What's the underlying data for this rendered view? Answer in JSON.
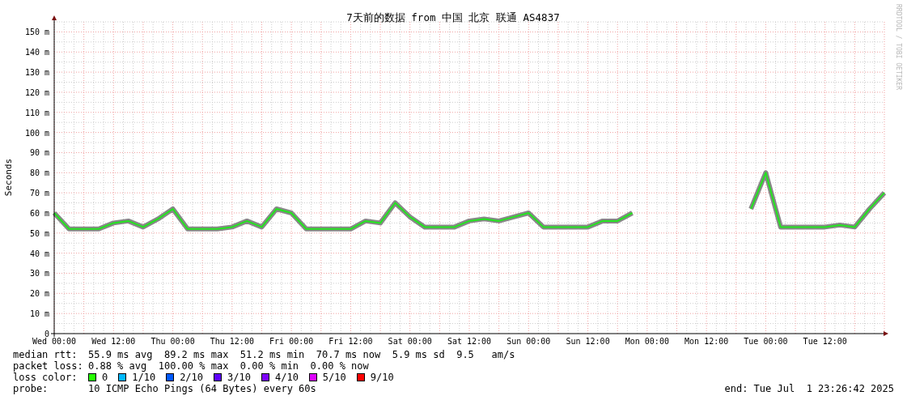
{
  "chart": {
    "chart_data": {
      "type": "line",
      "title": "7天前的数据 from 中国 北京 联通 AS4837",
      "ylabel": "Seconds",
      "categories": [
        "Wed 00:00",
        null,
        null,
        null,
        "Wed 12:00",
        null,
        null,
        null,
        "Thu 00:00",
        null,
        null,
        null,
        "Thu 12:00",
        null,
        null,
        null,
        "Fri 00:00",
        null,
        null,
        null,
        "Fri 12:00",
        null,
        null,
        null,
        "Sat 00:00",
        null,
        null,
        null,
        "Sat 12:00",
        null,
        null,
        null,
        "Sun 00:00",
        null,
        null,
        null,
        "Sun 12:00",
        null,
        null,
        null,
        "Mon 00:00",
        null,
        null,
        null,
        "Mon 12:00",
        null,
        null,
        null,
        "Tue 00:00",
        null,
        null,
        null,
        "Tue 12:00",
        null,
        null,
        null,
        null
      ],
      "series": [
        {
          "color": "#22e41e",
          "values": [
            60,
            52,
            52,
            52,
            55,
            56,
            53,
            57,
            62,
            52,
            52,
            52,
            53,
            56,
            53,
            62,
            60,
            52,
            52,
            52,
            52,
            56,
            55,
            65,
            58,
            53,
            53,
            53,
            56,
            57,
            56,
            58,
            60,
            53,
            53,
            53,
            53,
            56,
            56,
            60,
            null,
            null,
            null,
            null,
            null,
            null,
            null,
            62,
            80,
            53,
            53,
            53,
            53,
            54,
            53,
            62,
            70
          ]
        }
      ],
      "ylim": [
        0,
        155
      ],
      "grid": true,
      "yticks": [
        {
          "value": 0,
          "label": "0"
        },
        {
          "value": 10,
          "label": "10 m"
        },
        {
          "value": 20,
          "label": "20 m"
        },
        {
          "value": 30,
          "label": "30 m"
        },
        {
          "value": 40,
          "label": "40 m"
        },
        {
          "value": 50,
          "label": "50 m"
        },
        {
          "value": 60,
          "label": "60 m"
        },
        {
          "value": 70,
          "label": "70 m"
        },
        {
          "value": 80,
          "label": "80 m"
        },
        {
          "value": 90,
          "label": "90 m"
        },
        {
          "value": 100,
          "label": "100 m"
        },
        {
          "value": 110,
          "label": "110 m"
        },
        {
          "value": 120,
          "label": "120 m"
        },
        {
          "value": 130,
          "label": "130 m"
        },
        {
          "value": 140,
          "label": "140 m"
        },
        {
          "value": 150,
          "label": "150 m"
        }
      ]
    },
    "credit": "RRDTOOL / TOBI OETIKER"
  },
  "stats": [
    {
      "label": "median rtt:",
      "value": "55.9 ms avg  89.2 ms max  51.2 ms min  70.7 ms now  5.9 ms sd  9.5   am/s"
    },
    {
      "label": "packet loss:",
      "value": "0.88 % avg  100.00 % max  0.00 % min  0.00 % now"
    }
  ],
  "loss_colors": {
    "label": "loss color:",
    "items": [
      {
        "label": "0",
        "color": "#26ff00"
      },
      {
        "label": "1/10",
        "color": "#00b8ff"
      },
      {
        "label": "2/10",
        "color": "#0059ff"
      },
      {
        "label": "3/10",
        "color": "#5e00ff"
      },
      {
        "label": "4/10",
        "color": "#7e00ff"
      },
      {
        "label": "5/10",
        "color": "#dd00ff"
      },
      {
        "label": "9/10",
        "color": "#ff0000"
      }
    ]
  },
  "probe": {
    "label": "probe:",
    "value": "10 ICMP Echo Pings (64 Bytes) every 60s"
  },
  "end": "end: Tue Jul  1 23:26:42 2025"
}
